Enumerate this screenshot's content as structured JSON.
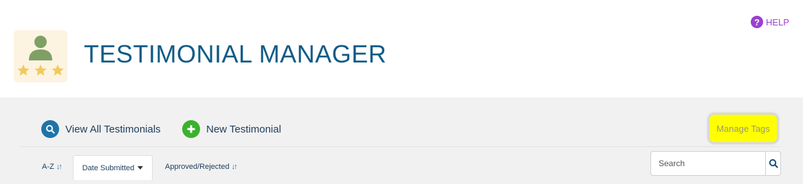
{
  "header": {
    "title": "TESTIMONIAL MANAGER",
    "logo_icon": "testimonial-stars-icon",
    "help_label": "HELP",
    "help_icon": "question-circle-icon"
  },
  "actions": {
    "view_all_label": "View All Testimonials",
    "view_all_icon": "search-icon",
    "new_label": "New Testimonial",
    "new_icon": "plus-circle-icon",
    "manage_tags_label": "Manage Tags"
  },
  "sort": {
    "az_label": "A-Z",
    "date_label": "Date Submitted",
    "approved_label": "Approved/Rejected",
    "active": "Date Submitted"
  },
  "search": {
    "placeholder": "Search",
    "icon": "search-icon"
  },
  "colors": {
    "title": "#0f5b86",
    "help": "#9b3fd0",
    "view_icon_bg": "#1d74a8",
    "new_icon_bg": "#3bb12c",
    "highlight": "#ffff00",
    "toolbar_bg": "#f1f1f1"
  }
}
